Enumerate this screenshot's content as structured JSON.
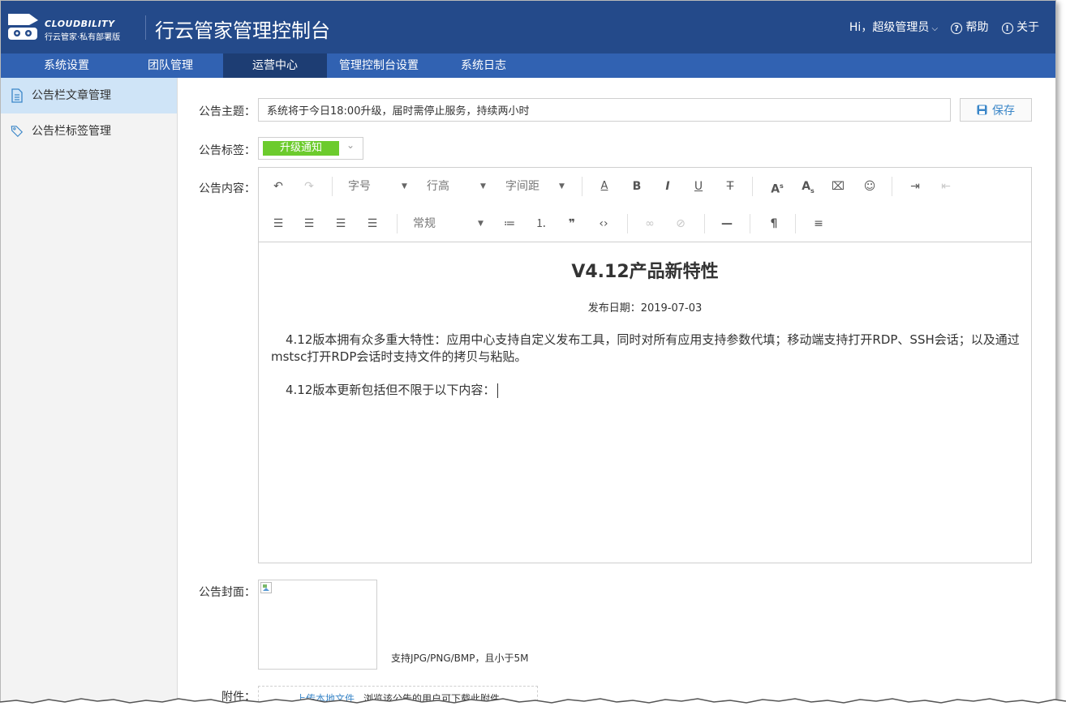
{
  "header": {
    "logo_en": "CLOUDBILITY",
    "logo_cn": "行云管家·私有部署版",
    "title": "行云管家管理控制台",
    "greeting": "Hi，超级管理员",
    "help_label": "帮助",
    "about_label": "关于"
  },
  "nav": {
    "items": [
      {
        "label": "系统设置"
      },
      {
        "label": "团队管理"
      },
      {
        "label": "运营中心"
      },
      {
        "label": "管理控制台设置"
      },
      {
        "label": "系统日志"
      }
    ],
    "active_index": 2
  },
  "sidebar": {
    "items": [
      {
        "label": "公告栏文章管理",
        "icon": "document-icon",
        "active": true
      },
      {
        "label": "公告栏标签管理",
        "icon": "tag-icon",
        "active": false
      }
    ]
  },
  "form": {
    "subject_label": "公告主题：",
    "subject_value": "系统将于今日18:00升级，届时需停止服务，持续两小时",
    "save_label": "保存",
    "tag_label": "公告标签：",
    "tag_value": "升级通知",
    "content_label": "公告内容：",
    "cover_label": "公告封面：",
    "cover_hint": "支持JPG/PNG/BMP，且小于5M",
    "attach_label": "附件：",
    "attach_link": "上传本地文件",
    "attach_hint": "浏览该公告的用户可下载此附件"
  },
  "toolbar": {
    "font_size": "字号",
    "line_height": "行高",
    "letter_spacing": "字间距",
    "paragraph": "常规",
    "bold": "B",
    "italic": "I",
    "underline": "U",
    "strike": "T"
  },
  "article": {
    "title": "V4.12产品新特性",
    "date": "发布日期：2019-07-03",
    "para1": "4.12版本拥有众多重大特性：应用中心支持自定义发布工具，同时对所有应用支持参数代填；移动端支持打开RDP、SSH会话；以及通过mstsc打开RDP会话时支持文件的拷贝与粘贴。",
    "para2": "4.12版本更新包括但不限于以下内容："
  },
  "colors": {
    "header_bg": "#244a8a",
    "nav_bg": "#3162b2",
    "nav_active": "#1d3d73",
    "tag_green": "#6ccb2d",
    "link_blue": "#3a86c8"
  }
}
